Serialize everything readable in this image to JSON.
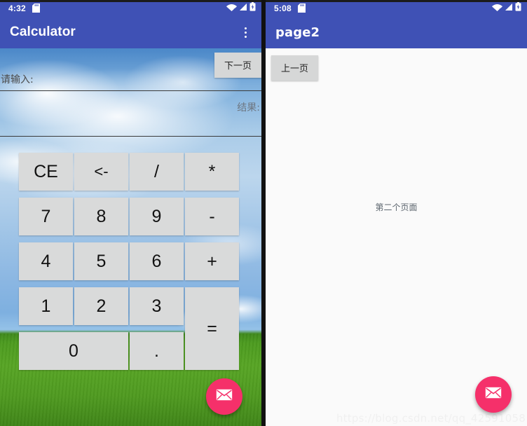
{
  "colors": {
    "appbar": "#3f51b5",
    "statusbar": "#3f51b5",
    "fab": "#f5306a",
    "key_face": "#d9dada",
    "page2_bg": "#fafafa"
  },
  "left_phone": {
    "status": {
      "time": "4:32",
      "left_icon": "sd-card-icon",
      "right_icons": [
        "wifi-off-icon",
        "signal-icon",
        "battery-icon"
      ]
    },
    "appbar": {
      "title": "Calculator",
      "overflow_icon": "more-vertical-icon"
    },
    "next_page_button": "下一页",
    "input_label": "请输入:",
    "input_value": "",
    "result_label": "结果:",
    "result_value": "",
    "keys": [
      {
        "label": "CE",
        "name": "key-ce",
        "span": ""
      },
      {
        "label": "<-",
        "name": "key-backspace",
        "span": ""
      },
      {
        "label": "/",
        "name": "key-divide",
        "span": ""
      },
      {
        "label": "*",
        "name": "key-multiply",
        "span": ""
      },
      {
        "label": "7",
        "name": "key-7",
        "span": ""
      },
      {
        "label": "8",
        "name": "key-8",
        "span": ""
      },
      {
        "label": "9",
        "name": "key-9",
        "span": ""
      },
      {
        "label": "-",
        "name": "key-minus",
        "span": ""
      },
      {
        "label": "4",
        "name": "key-4",
        "span": ""
      },
      {
        "label": "5",
        "name": "key-5",
        "span": ""
      },
      {
        "label": "6",
        "name": "key-6",
        "span": ""
      },
      {
        "label": "+",
        "name": "key-plus",
        "span": ""
      },
      {
        "label": "1",
        "name": "key-1",
        "span": ""
      },
      {
        "label": "2",
        "name": "key-2",
        "span": ""
      },
      {
        "label": "3",
        "name": "key-3",
        "span": ""
      },
      {
        "label": "=",
        "name": "key-equals",
        "span": "tall"
      },
      {
        "label": "0",
        "name": "key-0",
        "span": "wide"
      },
      {
        "label": ".",
        "name": "key-decimal",
        "span": ""
      }
    ],
    "fab_icon": "envelope-icon"
  },
  "right_phone": {
    "status": {
      "time": "5:08",
      "left_icon": "sd-card-icon",
      "right_icons": [
        "wifi-off-icon",
        "signal-icon",
        "battery-icon"
      ]
    },
    "appbar": {
      "title": "page2"
    },
    "prev_page_button": "上一页",
    "center_text": "第二个页面",
    "fab_icon": "envelope-icon",
    "watermark": "https://blog.csdn.net/qq_42591058"
  }
}
